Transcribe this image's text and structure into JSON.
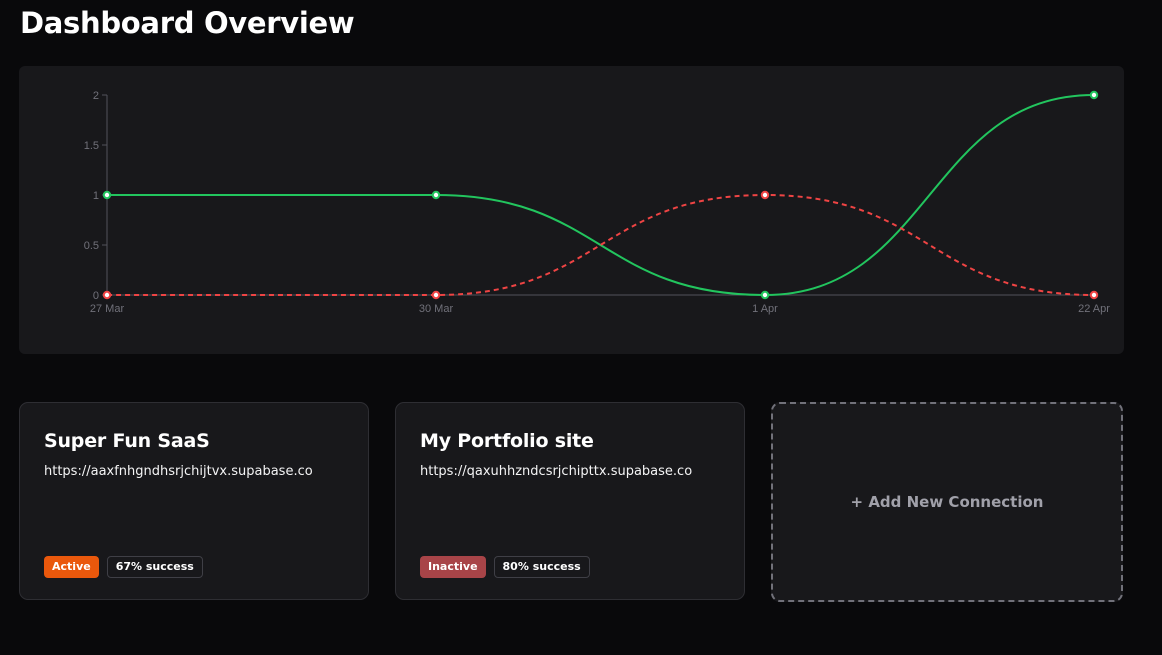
{
  "page": {
    "title": "Dashboard Overview"
  },
  "colors": {
    "background": "#09090b",
    "panel": "#18181b",
    "active_series": "#22c55e",
    "inactive_series": "#ef4444",
    "active_badge": "#ea580c",
    "inactive_badge": "#a84448"
  },
  "chart_data": {
    "type": "line",
    "x": [
      "27 Mar",
      "30 Mar",
      "1 Apr",
      "22 Apr"
    ],
    "yticks": [
      "0",
      "0.5",
      "1",
      "1.5",
      "2"
    ],
    "ylim": [
      0,
      2
    ],
    "grid": false,
    "legend": "none",
    "series": [
      {
        "values": [
          1,
          1,
          0,
          2
        ],
        "color": "#22c55e",
        "style": "solid"
      },
      {
        "values": [
          0,
          0,
          1,
          0
        ],
        "color": "#ef4444",
        "style": "dashed"
      }
    ]
  },
  "connections": [
    {
      "name": "Super Fun SaaS",
      "url": "https://aaxfnhgndhsrjchijtvx.supabase.co",
      "status": "Active",
      "success": "67% success"
    },
    {
      "name": "My Portfolio site",
      "url": "https://qaxuhhzndcsrjchipttx.supabase.co",
      "status": "Inactive",
      "success": "80% success"
    }
  ],
  "add_connection": {
    "label": "+ Add New Connection"
  }
}
